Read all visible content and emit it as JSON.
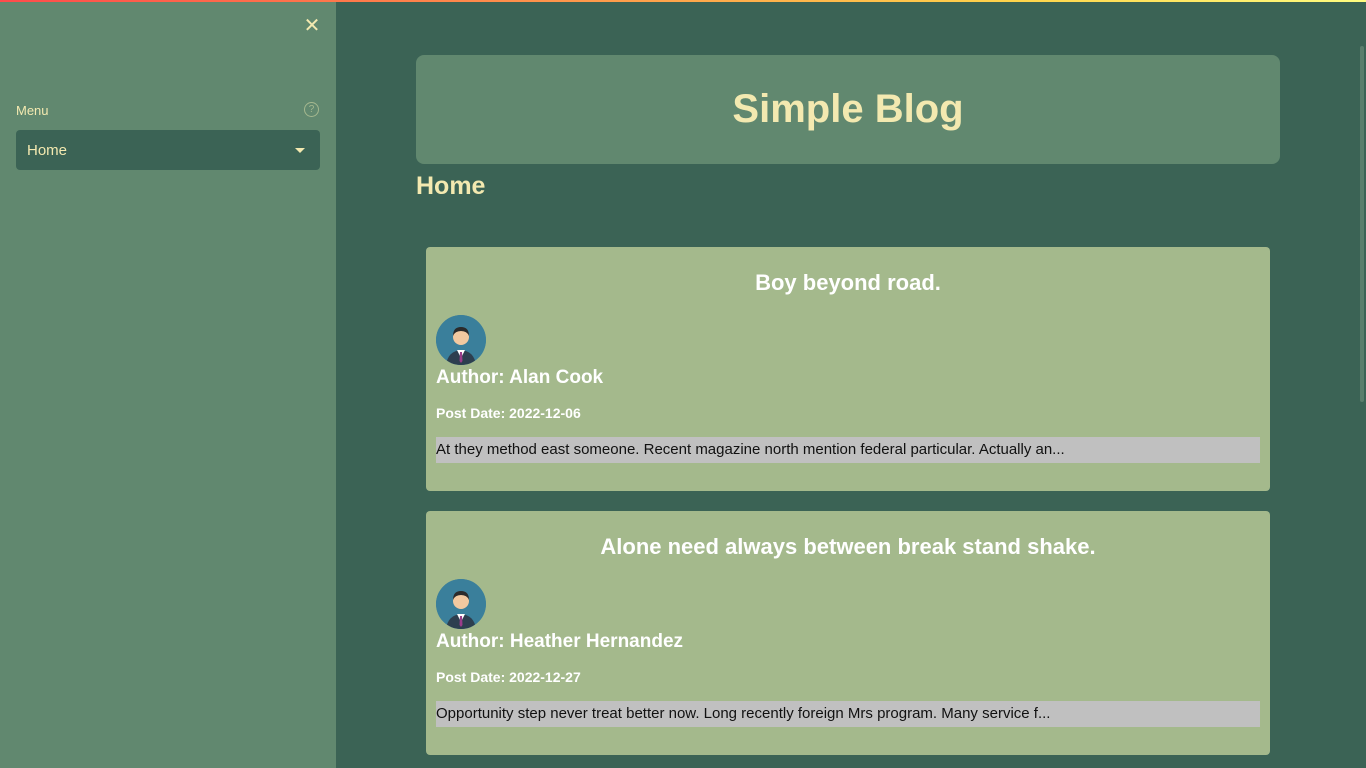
{
  "sidebar": {
    "close_glyph": "✕",
    "menu_label": "Menu",
    "help_glyph": "?",
    "select_value": "Home"
  },
  "header": {
    "site_title": "Simple Blog"
  },
  "main": {
    "page_heading": "Home",
    "posts": [
      {
        "title": "Boy beyond road.",
        "author": "Author: Alan Cook",
        "date": "Post Date: 2022-12-06",
        "excerpt": "At they method east someone. Recent magazine north mention federal particular. Actually an..."
      },
      {
        "title": "Alone need always between break stand shake.",
        "author": "Author: Heather Hernandez",
        "date": "Post Date: 2022-12-27",
        "excerpt": "Opportunity step never treat better now. Long recently foreign Mrs program. Many service f..."
      }
    ]
  },
  "colors": {
    "sidebar_bg": "#61886f",
    "main_bg": "#3b6355",
    "card_bg": "#a4b98c",
    "accent_text": "#f3e9b0",
    "excerpt_bg": "#c0c0c0"
  },
  "icons": {
    "close": "close-icon",
    "help": "help-icon",
    "dropdown": "chevron-down-icon",
    "avatar": "user-avatar-icon"
  }
}
